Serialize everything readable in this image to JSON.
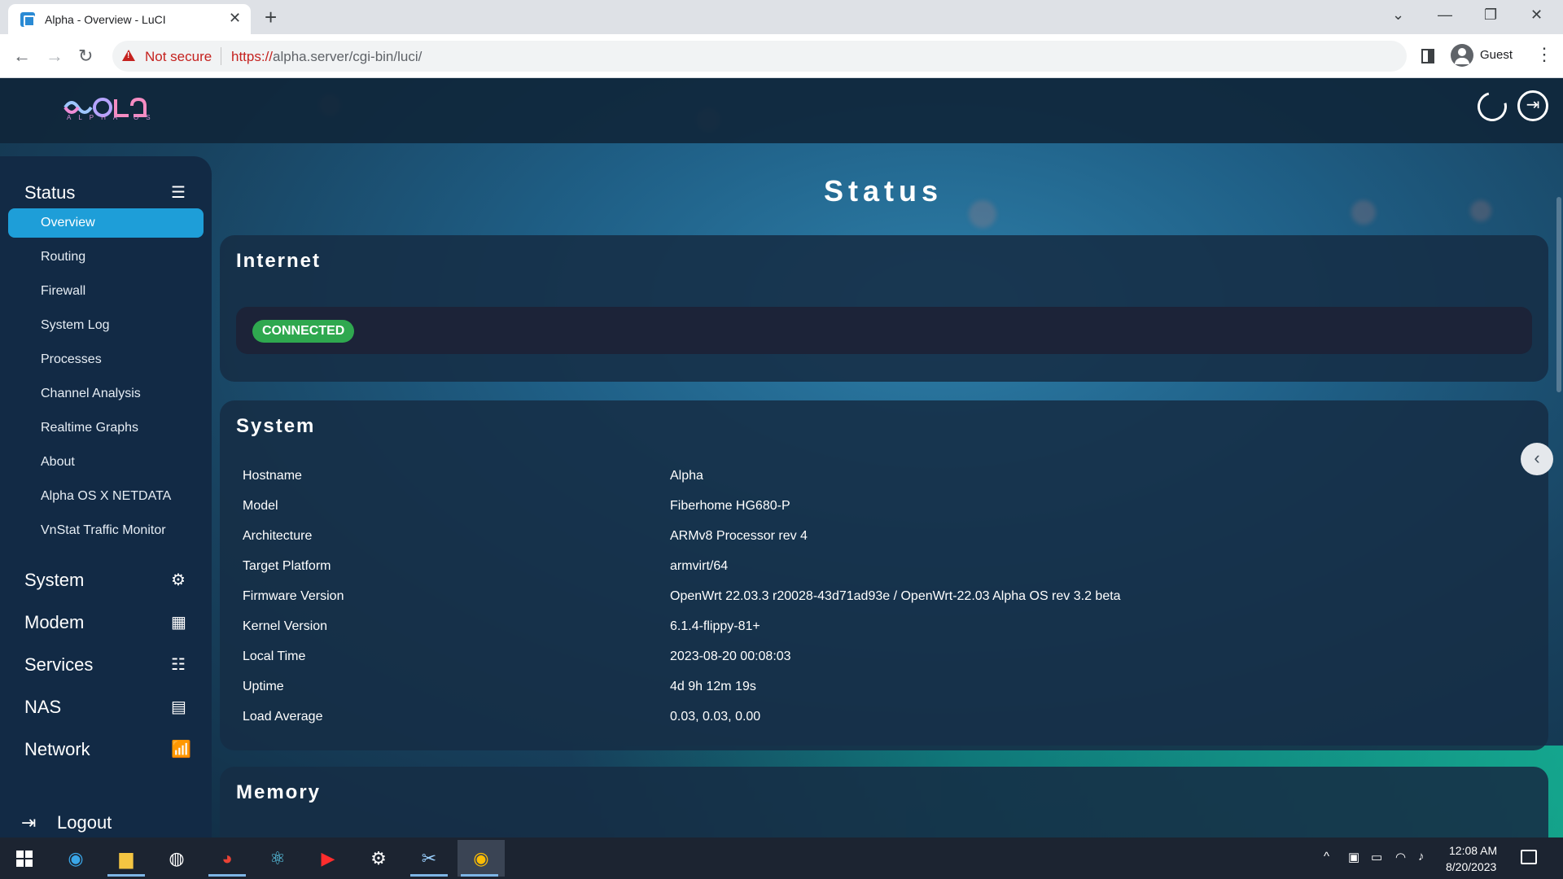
{
  "browser": {
    "tab_title": "Alpha - Overview - LuCI",
    "tab_close": "✕",
    "new_tab": "+",
    "not_secure": "Not secure",
    "url_scheme": "https://",
    "url_rest": "alpha.server/cgi-bin/luci/",
    "profile": "Guest"
  },
  "header": {
    "logo_text": "ALPHA OS"
  },
  "sidebar": {
    "status_label": "Status",
    "sub_items": [
      {
        "label": "Overview",
        "active": true
      },
      {
        "label": "Routing"
      },
      {
        "label": "Firewall"
      },
      {
        "label": "System Log"
      },
      {
        "label": "Processes"
      },
      {
        "label": "Channel Analysis"
      },
      {
        "label": "Realtime Graphs"
      },
      {
        "label": "About"
      },
      {
        "label": "Alpha OS X NETDATA"
      },
      {
        "label": "VnStat Traffic Monitor"
      }
    ],
    "sections": [
      {
        "label": "System",
        "icon": "gear-icon"
      },
      {
        "label": "Modem",
        "icon": "modem-icon"
      },
      {
        "label": "Services",
        "icon": "sliders-icon"
      },
      {
        "label": "NAS",
        "icon": "storage-icon"
      },
      {
        "label": "Network",
        "icon": "antenna-icon"
      }
    ],
    "logout_label": "Logout"
  },
  "main": {
    "page_title": "Status",
    "internet": {
      "title": "Internet",
      "status_badge": "CONNECTED",
      "badge_color": "#2fa84f"
    },
    "system": {
      "title": "System",
      "rows": [
        {
          "label": "Hostname",
          "value": "Alpha"
        },
        {
          "label": "Model",
          "value": "Fiberhome HG680-P"
        },
        {
          "label": "Architecture",
          "value": "ARMv8 Processor rev 4"
        },
        {
          "label": "Target Platform",
          "value": "armvirt/64"
        },
        {
          "label": "Firmware Version",
          "value": "OpenWrt 22.03.3 r20028-43d71ad93e / OpenWrt-22.03 Alpha OS rev 3.2 beta"
        },
        {
          "label": "Kernel Version",
          "value": "6.1.4-flippy-81+"
        },
        {
          "label": "Local Time",
          "value": "2023-08-20 00:08:03"
        },
        {
          "label": "Uptime",
          "value": "4d 9h 12m 19s"
        },
        {
          "label": "Load Average",
          "value": "0.03, 0.03, 0.00"
        }
      ]
    },
    "memory": {
      "title": "Memory"
    }
  },
  "taskbar": {
    "time": "12:08 AM",
    "date": "8/20/2023"
  },
  "colors": {
    "accent": "#1e9ed8",
    "sidebar_bg": "#122a45",
    "card_bg": "#162d46"
  }
}
